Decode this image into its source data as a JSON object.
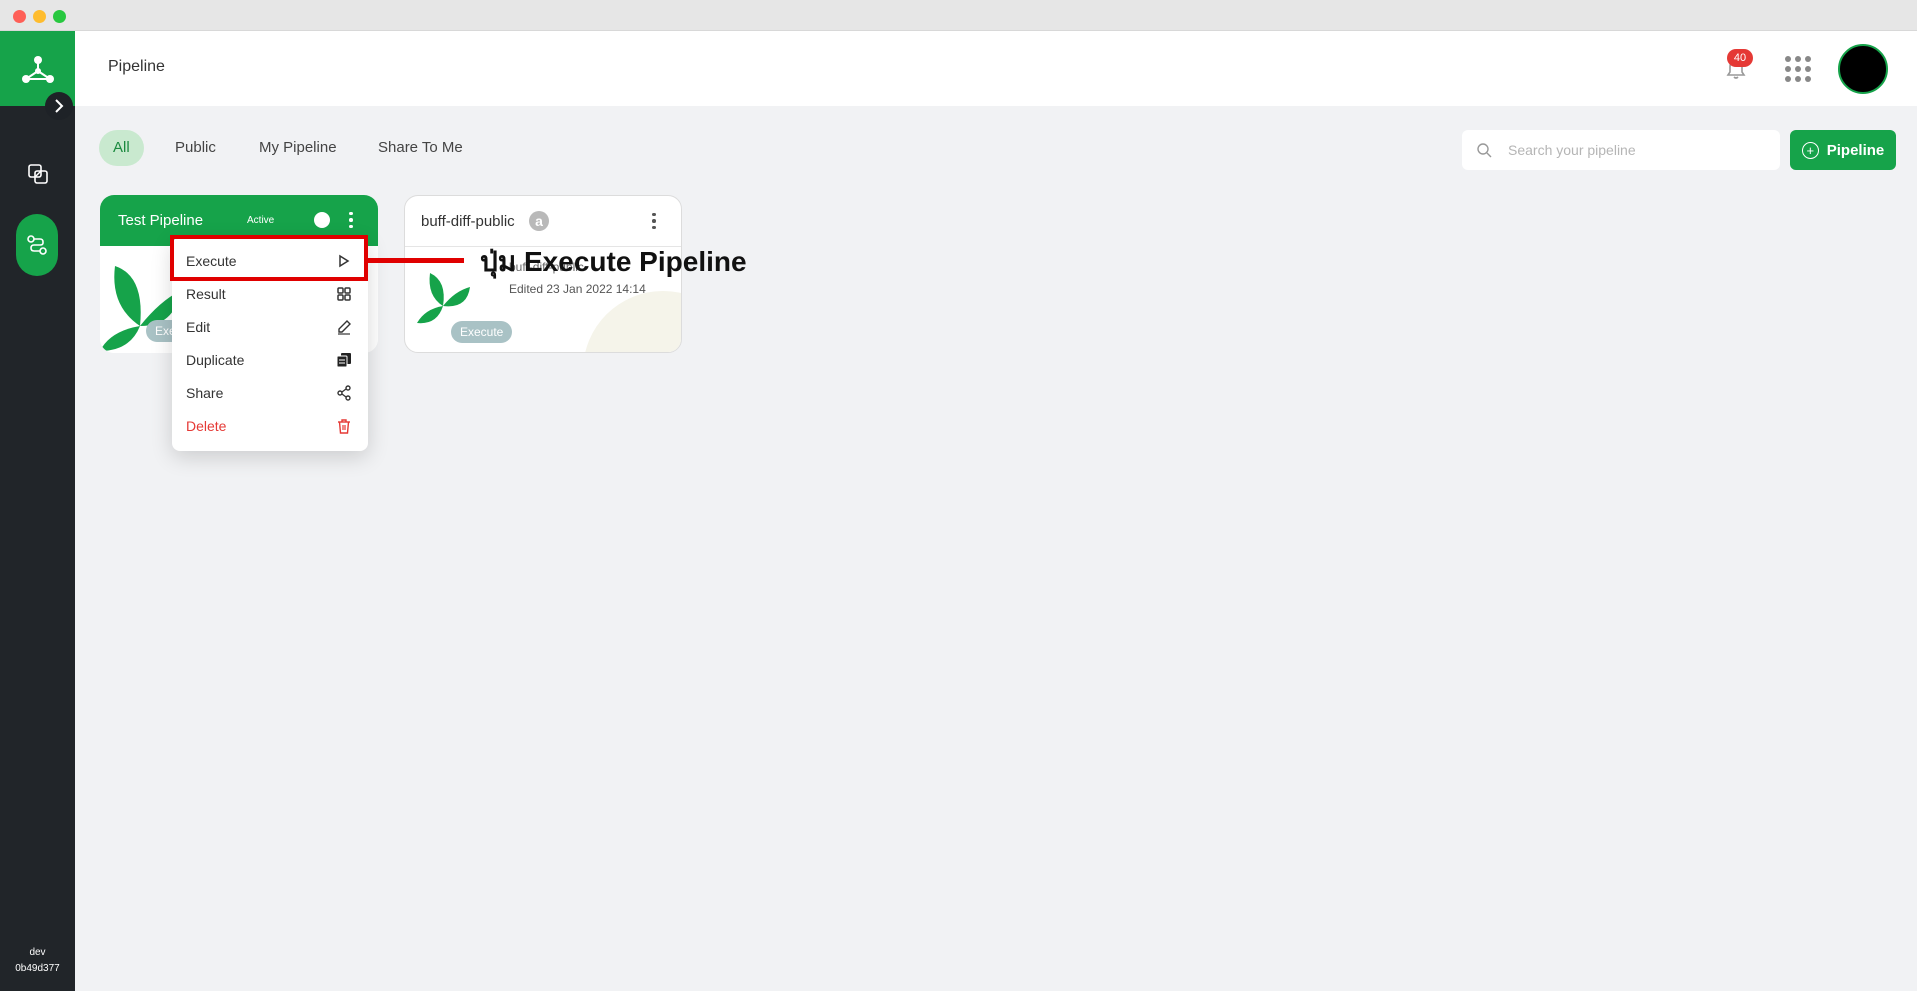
{
  "window": {
    "controls": [
      "close",
      "minimize",
      "maximize"
    ]
  },
  "sidebar": {
    "logo_icon": "molecule-logo-icon",
    "expand_icon": "chevron-right-icon",
    "items": [
      {
        "icon": "copy-icon",
        "active": false
      },
      {
        "icon": "pipeline-icon",
        "active": true
      }
    ],
    "env_name": "dev",
    "env_hash": "0b49d377"
  },
  "header": {
    "title": "Pipeline",
    "notification_count": "40",
    "apps_icon": "grid-icon"
  },
  "filters": {
    "tabs": [
      {
        "label": "All",
        "active": true
      },
      {
        "label": "Public",
        "active": false
      },
      {
        "label": "My Pipeline",
        "active": false
      },
      {
        "label": "Share To Me",
        "active": false
      }
    ]
  },
  "search": {
    "placeholder": "Search your pipeline",
    "value": ""
  },
  "add_button": {
    "label": "Pipeline"
  },
  "cards": [
    {
      "title": "Test Pipeline",
      "status": "Active",
      "toggle_on": true,
      "button_label": "Exec"
    },
    {
      "title": "buff-diff-public",
      "badge": "a",
      "description": "buff-diff-public",
      "edited": "Edited 23 Jan 2022 14:14",
      "button_label": "Execute"
    }
  ],
  "context_menu": {
    "items": [
      {
        "label": "Execute",
        "icon": "play-icon"
      },
      {
        "label": "Result",
        "icon": "grid-icon"
      },
      {
        "label": "Edit",
        "icon": "pencil-icon"
      },
      {
        "label": "Duplicate",
        "icon": "duplicate-icon"
      },
      {
        "label": "Share",
        "icon": "share-icon"
      },
      {
        "label": "Delete",
        "icon": "trash-icon",
        "danger": true
      }
    ]
  },
  "annotation": {
    "text": "ปุ่ม Execute Pipeline",
    "color": "#e00000"
  },
  "colors": {
    "brand": "#16a34a",
    "sidebar": "#212529",
    "danger": "#e53935"
  }
}
